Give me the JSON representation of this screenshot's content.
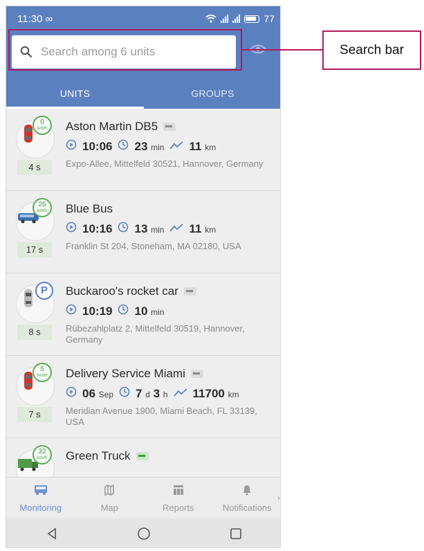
{
  "status_bar": {
    "time": "11:30",
    "link_glyph": "∞",
    "battery": "77"
  },
  "search": {
    "placeholder": "Search among 6 units"
  },
  "tabs": [
    {
      "label": "UNITS",
      "active": true
    },
    {
      "label": "GROUPS",
      "active": false
    }
  ],
  "units": [
    {
      "name": "Aston Martin DB5",
      "speed": "0",
      "speed_unit": "km/h",
      "age": "4 s",
      "time": "10:06",
      "duration_value": "23",
      "duration_unit": "min",
      "distance_value": "11",
      "distance_unit": "km",
      "address": "Expo-Allee, Mittelfeld 30521, Hannover, Germany",
      "vehicle_icon": "red-car-icon",
      "ignition": "off"
    },
    {
      "name": "Blue Bus",
      "speed": "26",
      "speed_unit": "km/h",
      "age": "17 s",
      "time": "10:16",
      "duration_value": "13",
      "duration_unit": "min",
      "distance_value": "11",
      "distance_unit": "km",
      "address": "Franklin St 204, Stoneham, MA 02180, USA",
      "vehicle_icon": "blue-bus-icon"
    },
    {
      "name": "Buckaroo's rocket car",
      "parked_label": "P",
      "age": "8 s",
      "time": "10:19",
      "duration_value": "10",
      "duration_unit": "min",
      "address": "Rübezahlplatz 2, Mittelfeld 30519, Hannover, Germany",
      "vehicle_icon": "grey-car-icon",
      "ignition": "off"
    },
    {
      "name": "Delivery Service Miami",
      "speed": "5",
      "speed_unit": "km/h",
      "age": "7 s",
      "time_day": "06",
      "time_month": "Sep",
      "duration_d": "7",
      "duration_d_unit": "d",
      "duration_h": "3",
      "duration_h_unit": "h",
      "distance_value": "11700",
      "distance_unit": "km",
      "address": "Meridian Avenue 1900, Miami Beach, FL 33139, USA",
      "vehicle_icon": "red-car-icon",
      "ignition": "off"
    },
    {
      "name": "Green Truck",
      "speed": "32",
      "speed_unit": "km/h",
      "vehicle_icon": "green-truck-icon",
      "ignition": "on"
    }
  ],
  "bottom_nav": [
    {
      "label": "Monitoring",
      "icon": "bus-icon",
      "active": true
    },
    {
      "label": "Map",
      "icon": "map-icon",
      "active": false
    },
    {
      "label": "Reports",
      "icon": "reports-icon",
      "active": false
    },
    {
      "label": "Notifications",
      "icon": "bell-icon",
      "active": false
    }
  ],
  "callout": {
    "label": "Search bar"
  },
  "colors": {
    "brand": "#5b80bf",
    "callout": "#b3185e",
    "speed_ring": "#5aaa5a"
  }
}
